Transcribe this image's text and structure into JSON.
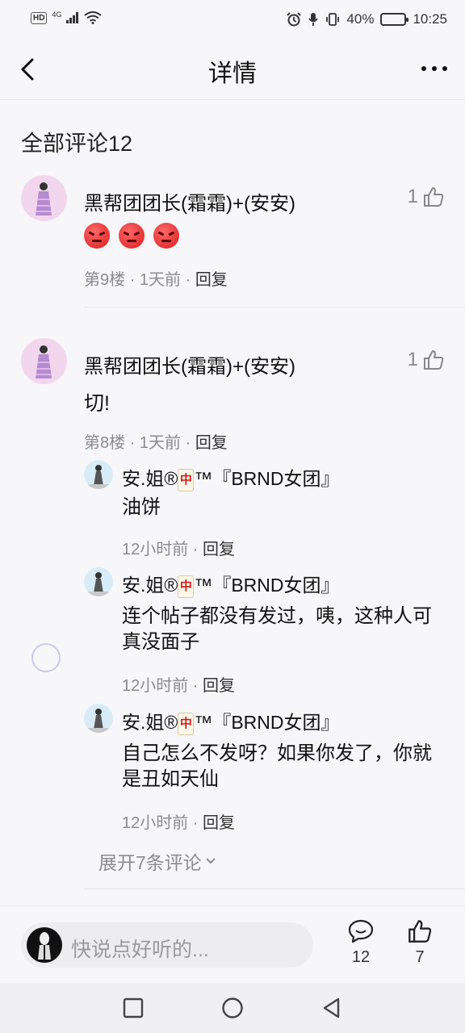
{
  "status_bar": {
    "hd": "HD",
    "network": "4G",
    "battery": "40%",
    "time": "10:25"
  },
  "nav": {
    "title": "详情"
  },
  "section_title": "全部评论12",
  "comments": [
    {
      "name": "黑帮团团长(霜霜)+(安安)",
      "likes": "1",
      "floor": "第9楼",
      "time": "1天前",
      "reply_label": "回复",
      "emojis": [
        "angry-face",
        "angry-face",
        "angry-face"
      ]
    },
    {
      "name": "黑帮团团长(霜霜)+(安安)",
      "likes": "1",
      "content": "切!",
      "floor": "第8楼",
      "time": "1天前",
      "reply_label": "回复",
      "replies": [
        {
          "name_prefix": "安.姐®",
          "name_tile": "中",
          "name_suffix": "™『BRND女团』",
          "content": "油饼",
          "time": "12小时前",
          "reply_label": "回复"
        },
        {
          "name_prefix": "安.姐®",
          "name_tile": "中",
          "name_suffix": "™『BRND女团』",
          "content": "连个帖子都没有发过，咦，这种人可真没面子",
          "time": "12小时前",
          "reply_label": "回复"
        },
        {
          "name_prefix": "安.姐®",
          "name_tile": "中",
          "name_suffix": "™『BRND女团』",
          "content": "自己怎么不发呀？如果你发了，你就是丑如天仙",
          "time": "12小时前",
          "reply_label": "回复"
        }
      ],
      "expand_label": "展开7条评论"
    }
  ],
  "bottom_bar": {
    "placeholder": "快说点好听的...",
    "comment_count": "12",
    "like_count": "7"
  },
  "colors": {
    "background": "#f7f7f9",
    "meta_text": "#8c8c8c",
    "avatar_pink": "#f2d6ee",
    "tile_red": "#d21e1e"
  }
}
